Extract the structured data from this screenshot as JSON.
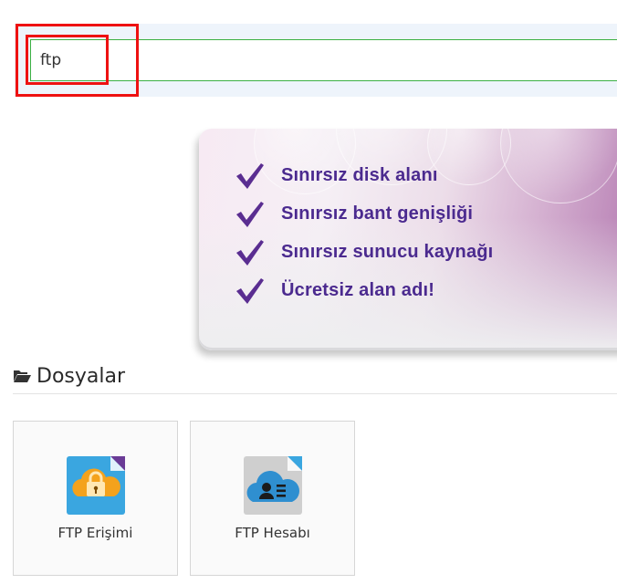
{
  "search": {
    "value": "ftp"
  },
  "banner": {
    "features": [
      "Sınırsız disk alanı",
      "Sınırsız bant genişliği",
      "Sınırsız sunucu kaynağı",
      "Ücretsiz alan adı!"
    ],
    "text_color": "#4b2a8f",
    "check_color": "#5a2d91"
  },
  "section": {
    "title": "Dosyalar",
    "icon": "folder-open-icon"
  },
  "tiles": [
    {
      "label": "FTP Erişimi",
      "icon": "ftp-access-icon"
    },
    {
      "label": "FTP Hesabı",
      "icon": "ftp-account-icon"
    }
  ],
  "colors": {
    "highlight": "#ee1111",
    "input_border": "#3cb043"
  }
}
